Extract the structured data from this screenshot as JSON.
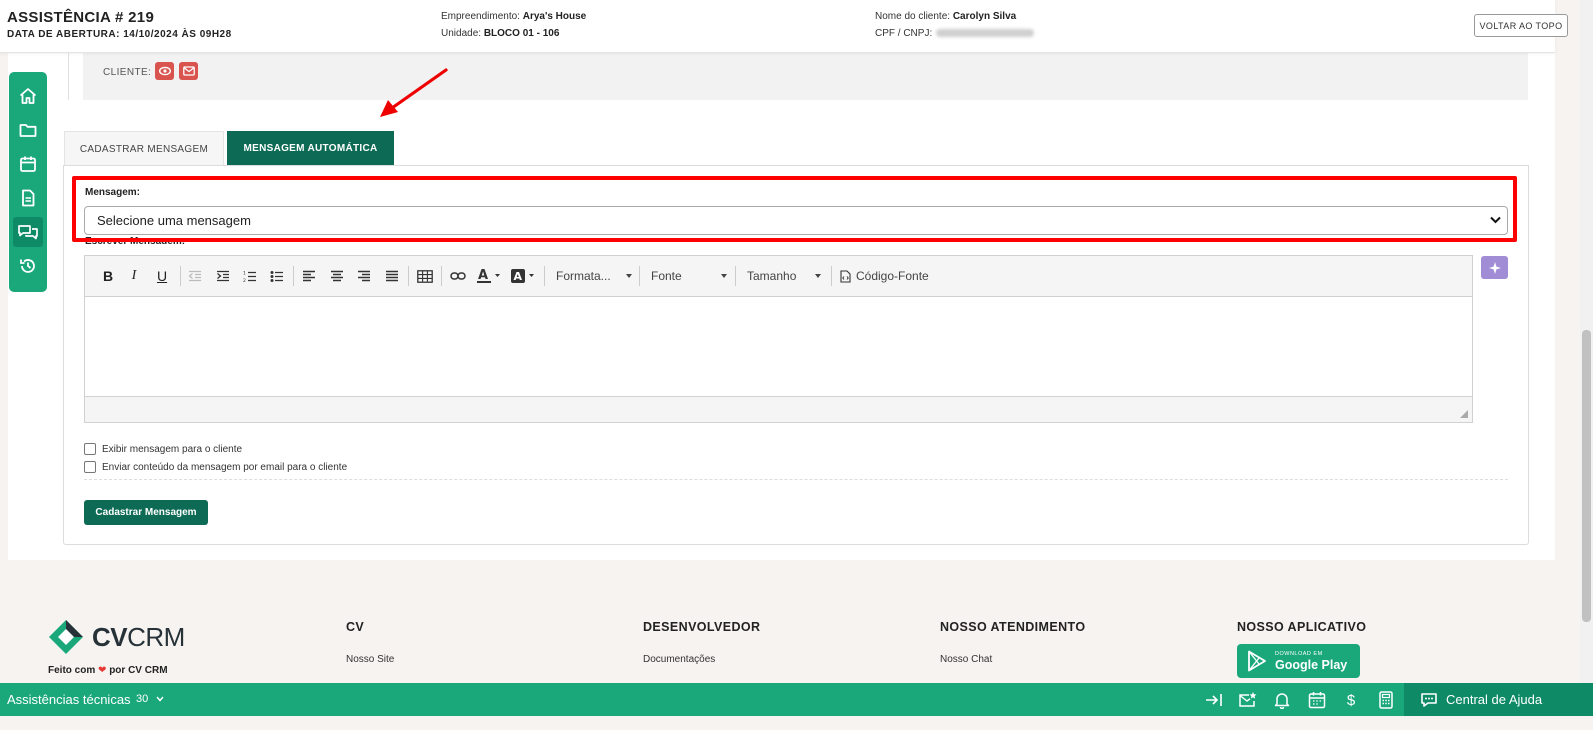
{
  "header": {
    "title": "ASSISTÊNCIA # 219",
    "opening_date": "DATA DE ABERTURA: 14/10/2024 ÀS 09H28",
    "empreendimento_label": "Empreendimento:",
    "empreendimento_value": "Arya's House",
    "unidade_label": "Unidade:",
    "unidade_value": "BLOCO 01 - 106",
    "cliente_label": "Nome do cliente:",
    "cliente_value": "Carolyn Silva",
    "cpf_label": "CPF / CNPJ:",
    "back_to_top": "VOLTAR AO TOPO"
  },
  "cliente_section": {
    "label": "CLIENTE:"
  },
  "sidenav": {
    "items": [
      {
        "icon": "home-icon"
      },
      {
        "icon": "folder-icon"
      },
      {
        "icon": "calendar-icon"
      },
      {
        "icon": "document-icon"
      },
      {
        "icon": "chat-icon",
        "active": true
      },
      {
        "icon": "history-icon"
      }
    ]
  },
  "tabs": [
    {
      "label": "CADASTRAR MENSAGEM",
      "active": false
    },
    {
      "label": "MENSAGEM AUTOMÁTICA",
      "active": true
    }
  ],
  "form": {
    "message_label": "Mensagem:",
    "message_select_value": "Selecione uma mensagem",
    "write_label": "Escrever Mensagem:",
    "toolbar": {
      "format": "Formata...",
      "font": "Fonte",
      "size": "Tamanho",
      "source": "Código-Fonte"
    },
    "checkbox_show_client": "Exibir mensagem para o cliente",
    "checkbox_email_client": "Enviar conteúdo da mensagem por email para o cliente",
    "submit_label": "Cadastrar Mensagem"
  },
  "footer": {
    "logo_cv": "CV",
    "logo_crm": "CRM",
    "made_with_prefix": "Feito com",
    "made_with_suffix": "por CV CRM",
    "columns": [
      {
        "title": "CV",
        "link": "Nosso Site"
      },
      {
        "title": "DESENVOLVEDOR",
        "link": "Documentações"
      },
      {
        "title": "NOSSO ATENDIMENTO",
        "link": "Nosso Chat"
      },
      {
        "title": "NOSSO APLICATIVO",
        "link": ""
      }
    ],
    "gplay_small": "DOWNLOAD EM",
    "gplay_big": "Google Play"
  },
  "bottombar": {
    "title": "Assistências técnicas",
    "count": "30",
    "help": "Central de Ajuda"
  },
  "colors": {
    "brand_green": "#1aa87a",
    "dark_green": "#0d6b55",
    "highlight_red": "#ff0000",
    "danger": "#d9534f"
  }
}
